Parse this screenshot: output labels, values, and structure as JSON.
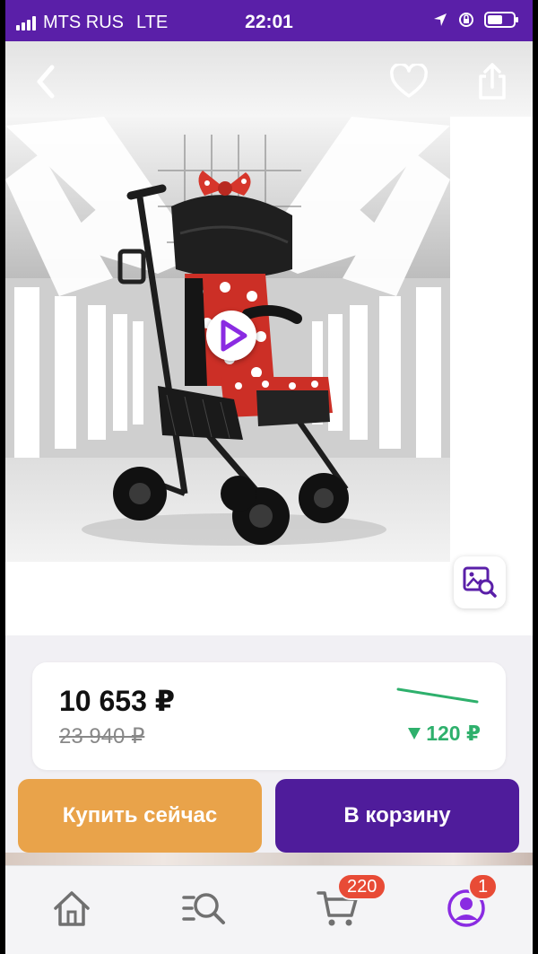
{
  "status_bar": {
    "carrier": "MTS RUS",
    "network": "LTE",
    "time": "22:01"
  },
  "icons": {
    "back": "chevron-left-icon",
    "favorite": "heart-icon",
    "share": "share-icon",
    "play": "play-icon",
    "image_search": "image-search-icon",
    "home": "home-icon",
    "catalog": "catalog-search-icon",
    "cart": "cart-icon",
    "profile": "profile-icon"
  },
  "product": {
    "image": "stroller-photo"
  },
  "price": {
    "current": "10 653 ₽",
    "old": "23 940 ₽",
    "drop": "120 ₽"
  },
  "actions": {
    "buy_now": "Купить сейчас",
    "add_to_cart": "В корзину"
  },
  "tabbar": {
    "cart_badge": "220",
    "profile_badge": "1"
  },
  "colors": {
    "brand_purple": "#5a1fa8",
    "cart_button": "#4f1c9b",
    "buy_button": "#e9a34a",
    "price_drop": "#2eb06c",
    "badge": "#e84b36",
    "play_accent": "#8a2be2"
  }
}
